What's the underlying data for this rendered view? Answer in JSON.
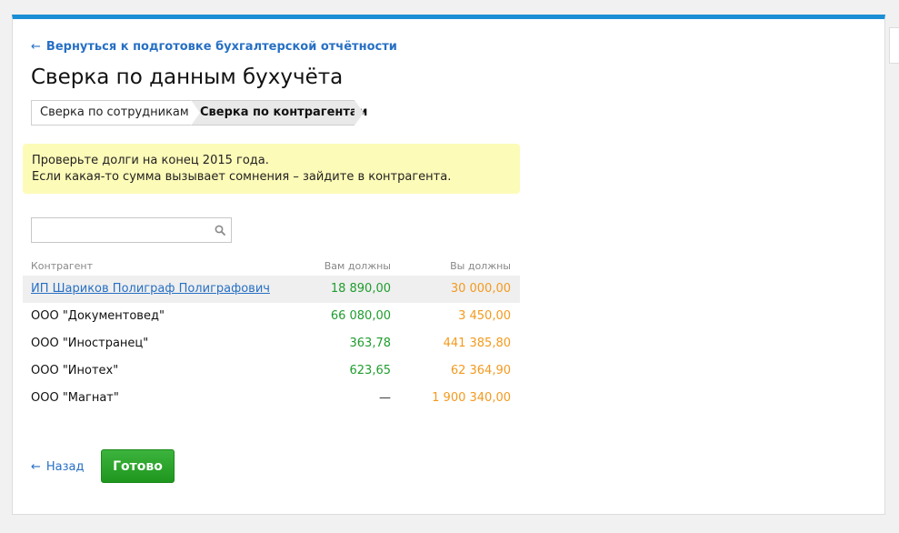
{
  "header": {
    "back_arrow": "←",
    "back_label": "Вернуться к подготовке бухгалтерской отчётности",
    "title": "Сверка по данным бухучёта"
  },
  "steps": [
    {
      "label": "Сверка по сотрудникам",
      "active": false
    },
    {
      "label": "Сверка по контрагентам",
      "active": true
    }
  ],
  "notice": {
    "line1": "Проверьте долги на конец 2015 года.",
    "line2": "Если какая-то сумма вызывает сомнения – зайдите в контрагента.",
    "color": "#fdfbb8"
  },
  "search": {
    "value": "",
    "placeholder": "",
    "icon": "search-icon"
  },
  "table": {
    "columns": {
      "name": "Контрагент",
      "owed_to_you": "Вам должны",
      "you_owe": "Вы должны"
    },
    "rows": [
      {
        "name": "ИП Шариков Полиграф Полиграфович",
        "owed_to_you": "18 890,00",
        "you_owe": "30 000,00"
      },
      {
        "name": "ООО \"Документовед\"",
        "owed_to_you": "66 080,00",
        "you_owe": "3 450,00"
      },
      {
        "name": "ООО \"Иностранец\"",
        "owed_to_you": "363,78",
        "you_owe": "441 385,80"
      },
      {
        "name": "ООО \"Инотех\"",
        "owed_to_you": "623,65",
        "you_owe": "62 364,90"
      },
      {
        "name": "ООО \"Магнат\"",
        "owed_to_you": "—",
        "you_owe": "1 900 340,00"
      }
    ]
  },
  "footer": {
    "back_arrow": "←",
    "back_label": "Назад",
    "done_label": "Готово"
  },
  "colors": {
    "accent_bar": "#1b8fd6",
    "link": "#2770c4",
    "positive": "#1f9d2e",
    "negative": "#f39a1e",
    "done_button": "#2aa52a"
  }
}
